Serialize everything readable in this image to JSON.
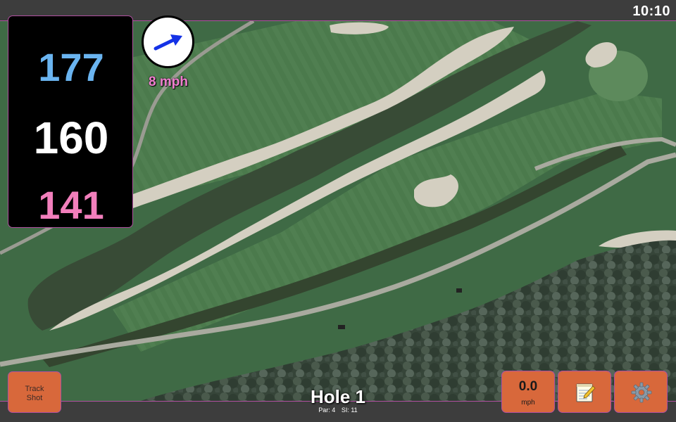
{
  "status_bar": {
    "time": "10:10"
  },
  "distances": {
    "back": "177",
    "middle": "160",
    "front": "141"
  },
  "wind": {
    "speed_label": "8 mph",
    "direction_icon": "arrow-icon"
  },
  "buttons": {
    "track_shot_line1": "Track",
    "track_shot_line2": "Shot",
    "wind_value": "0.0",
    "wind_unit": "mph",
    "scorecard_icon": "notepad-icon",
    "settings_icon": "gear-icon"
  },
  "hole": {
    "title": "Hole 1",
    "par": "Par: 4",
    "stroke_index": "SI: 11"
  },
  "colors": {
    "back_distance": "#6ab4f0",
    "middle_distance": "#ffffff",
    "front_distance": "#f27fbc",
    "accent": "#b04fa0",
    "button": "#d8683b",
    "wind_text": "#f07fcf"
  }
}
